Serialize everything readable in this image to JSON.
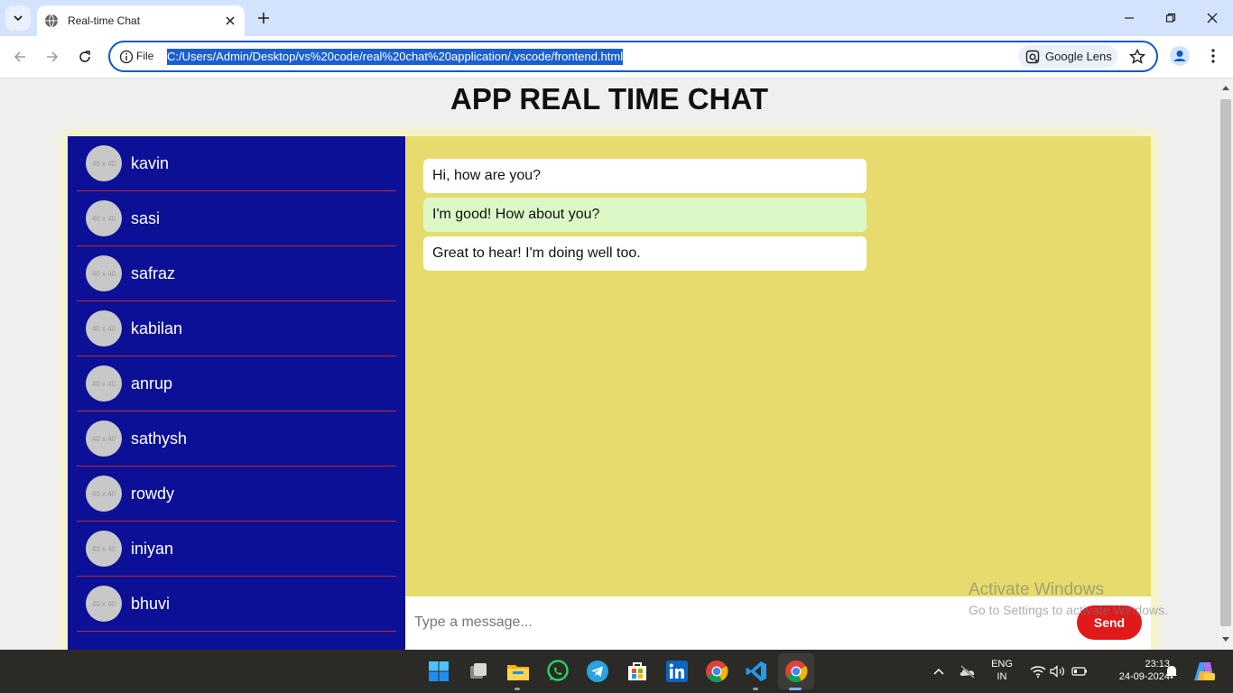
{
  "browser": {
    "tab_title": "Real-time Chat",
    "address_scheme": "File",
    "url": "C:/Users/Admin/Desktop/vs%20code/real%20chat%20application/.vscode/frontend.html",
    "lens_label": "Google Lens"
  },
  "page": {
    "title": "APP REAL TIME CHAT",
    "contacts": [
      {
        "name": "kavin",
        "avatar_text": "40 x 40"
      },
      {
        "name": "sasi",
        "avatar_text": "40 x 40"
      },
      {
        "name": "safraz",
        "avatar_text": "40 x 40"
      },
      {
        "name": "kabilan",
        "avatar_text": "40 x 40"
      },
      {
        "name": "anrup",
        "avatar_text": "40 x 40"
      },
      {
        "name": "sathysh",
        "avatar_text": "40 x 40"
      },
      {
        "name": "rowdy",
        "avatar_text": "40 x 40"
      },
      {
        "name": "iniyan",
        "avatar_text": "40 x 40"
      },
      {
        "name": "bhuvi",
        "avatar_text": "40 x 40"
      }
    ],
    "messages": [
      {
        "text": "Hi, how are you?",
        "type": "in"
      },
      {
        "text": "I'm good! How about you?",
        "type": "out"
      },
      {
        "text": "Great to hear! I'm doing well too.",
        "type": "in"
      }
    ],
    "input_placeholder": "Type a message...",
    "send_label": "Send",
    "colors": {
      "sidebar_bg": "#0c1096",
      "divider": "#c8272a",
      "chat_bg": "#e6db6c",
      "sent_bubble": "#dcf8c6",
      "send_button": "#e0191a"
    }
  },
  "watermark": {
    "line1": "Activate Windows",
    "line2": "Go to Settings to activate Windows."
  },
  "taskbar": {
    "lang_line1": "ENG",
    "lang_line2": "IN",
    "time": "23:13",
    "date": "24-09-2024",
    "apps": [
      "windows-start",
      "task-view",
      "file-explorer",
      "whatsapp",
      "telegram",
      "microsoft-store",
      "linkedin",
      "chrome",
      "vscode",
      "chrome-active"
    ]
  }
}
